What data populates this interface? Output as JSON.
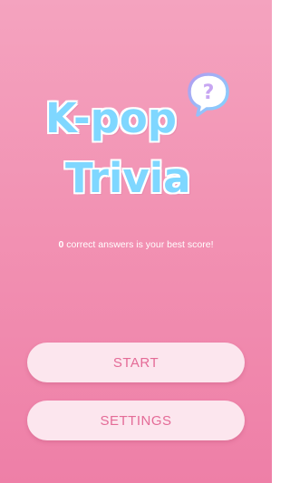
{
  "logo": {
    "line1": "K-pop",
    "line2": "Trivia",
    "bubble_glyph": "?",
    "icon": "question-bubble-icon"
  },
  "score": {
    "value": "0",
    "suffix": " correct answers is your best score!"
  },
  "buttons": {
    "start_label": "START",
    "settings_label": "SETTINGS"
  },
  "colors": {
    "background_top": "#f4a3bf",
    "background_bottom": "#ee7fa7",
    "logo_text": "#7fd7ff",
    "button_bg": "#fce6ee",
    "button_text": "#e46b97"
  }
}
